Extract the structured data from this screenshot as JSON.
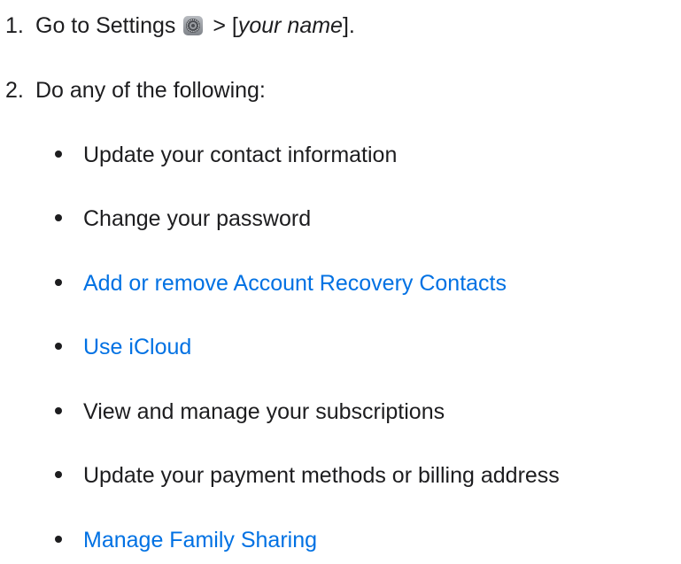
{
  "steps": [
    {
      "number": "1.",
      "text_before": "Go to Settings",
      "icon": "settings-gear-icon",
      "text_after": "> [",
      "italic": "your name",
      "text_end": "]."
    },
    {
      "number": "2.",
      "text": "Do any of the following:"
    }
  ],
  "items": [
    {
      "label": "Update your contact information",
      "link": false
    },
    {
      "label": "Change your password",
      "link": false
    },
    {
      "label": "Add or remove Account Recovery Contacts",
      "link": true
    },
    {
      "label": "Use iCloud",
      "link": true
    },
    {
      "label": "View and manage your subscriptions",
      "link": false
    },
    {
      "label": "Update your payment methods or billing address",
      "link": false
    },
    {
      "label": "Manage Family Sharing",
      "link": true
    }
  ],
  "colors": {
    "text": "#1d1d1f",
    "link": "#0071e3"
  }
}
